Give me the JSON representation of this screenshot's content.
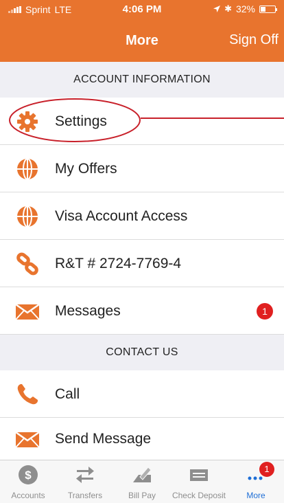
{
  "status": {
    "carrier": "Sprint",
    "network": "LTE",
    "time": "4:06 PM",
    "battery": "32%"
  },
  "nav": {
    "title": "More",
    "sign_off": "Sign Off"
  },
  "sections": {
    "account_information": "ACCOUNT INFORMATION",
    "contact_us": "CONTACT US"
  },
  "rows": {
    "settings": "Settings",
    "my_offers": "My Offers",
    "visa_access": "Visa Account Access",
    "rt_number": "R&T # 2724-7769-4",
    "messages": "Messages",
    "messages_badge": "1",
    "call": "Call",
    "send_message": "Send Message"
  },
  "tabs": {
    "accounts": "Accounts",
    "transfers": "Transfers",
    "bill_pay": "Bill Pay",
    "check_deposit": "Check Deposit",
    "more": "More",
    "more_badge": "1"
  },
  "colors": {
    "brand_orange": "#e8742e",
    "badge_red": "#e02020",
    "annotation_red": "#c8202a",
    "active_tab_blue": "#1e6ed6"
  }
}
